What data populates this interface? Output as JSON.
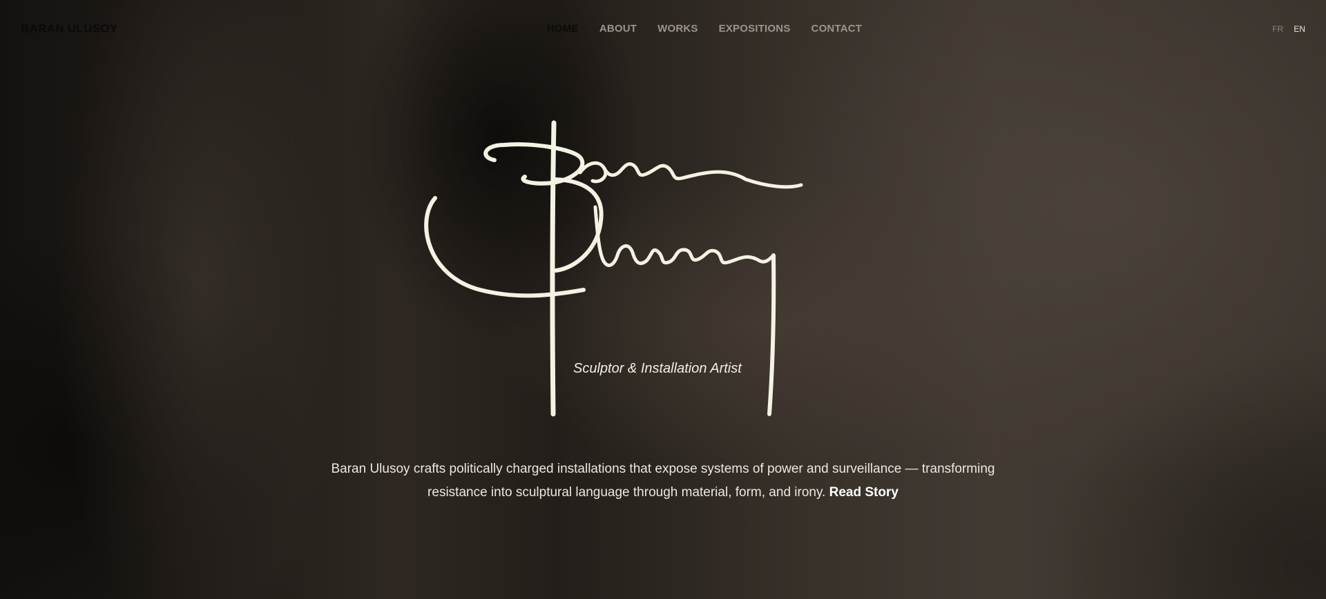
{
  "header": {
    "brand": "BARAN ULUSOY",
    "nav": [
      {
        "label": "HOME",
        "active": true
      },
      {
        "label": "ABOUT",
        "active": false
      },
      {
        "label": "WORKS",
        "active": false
      },
      {
        "label": "EXPOSITIONS",
        "active": false
      },
      {
        "label": "CONTACT",
        "active": false
      }
    ],
    "languages": [
      "FR",
      "EN"
    ],
    "active_language": "EN"
  },
  "hero": {
    "tagline": "Sculptor & Installation Artist",
    "description": "Baran Ulusoy crafts politically charged installations that expose systems of power and surveillance — transforming resistance into sculptural language through material, form, and irony.",
    "read_story_label": "Read Story"
  },
  "colors": {
    "signature": "#f4f2e2",
    "nav_inactive": "#9a948c",
    "nav_active": "#0b0a09",
    "text": "#ece8de"
  },
  "icons": {
    "signature_logo": "signature-logo-icon"
  }
}
